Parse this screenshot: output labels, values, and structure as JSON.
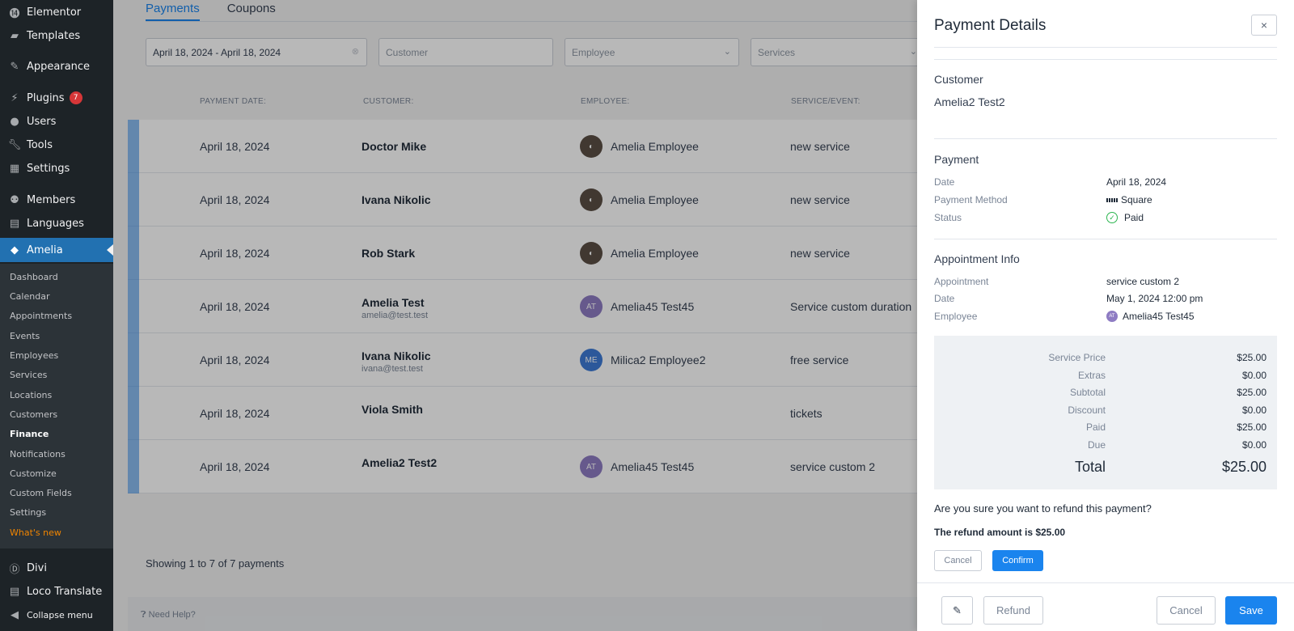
{
  "wp_menu": {
    "elementor": "Elementor",
    "templates": "Templates",
    "appearance": "Appearance",
    "plugins": "Plugins",
    "plugins_badge": "7",
    "users": "Users",
    "tools": "Tools",
    "settings": "Settings",
    "members": "Members",
    "languages": "Languages",
    "amelia": "Amelia",
    "divi": "Divi",
    "loco": "Loco Translate",
    "collapse": "Collapse menu"
  },
  "amelia_submenu": [
    "Dashboard",
    "Calendar",
    "Appointments",
    "Events",
    "Employees",
    "Services",
    "Locations",
    "Customers",
    "Finance",
    "Notifications",
    "Customize",
    "Custom Fields",
    "Settings",
    "What's new"
  ],
  "tabs": [
    "Payments",
    "Coupons"
  ],
  "filters": {
    "date_range": "April 18, 2024 - April 18, 2024",
    "customer_placeholder": "Customer",
    "employee_placeholder": "Employee",
    "services_placeholder": "Services"
  },
  "table": {
    "headers": [
      "PAYMENT DATE:",
      "CUSTOMER:",
      "EMPLOYEE:",
      "SERVICE/EVENT:"
    ],
    "rows": [
      {
        "date": "April 18, 2024",
        "customer": "Doctor Mike",
        "email": "",
        "avatar": "",
        "employee": "Amelia Employee",
        "service": "new service"
      },
      {
        "date": "April 18, 2024",
        "customer": "Ivana Nikolic",
        "email": "",
        "avatar": "",
        "employee": "Amelia Employee",
        "service": "new service"
      },
      {
        "date": "April 18, 2024",
        "customer": "Rob Stark",
        "email": "",
        "avatar": "",
        "employee": "Amelia Employee",
        "service": "new service"
      },
      {
        "date": "April 18, 2024",
        "customer": "Amelia Test",
        "email": "amelia@test.test",
        "avatar": "AT",
        "employee": "Amelia45 Test45",
        "service": "Service custom duration"
      },
      {
        "date": "April 18, 2024",
        "customer": "Ivana Nikolic",
        "email": "ivana@test.test",
        "avatar": "ME",
        "employee": "Milica2 Employee2",
        "service": "free service"
      },
      {
        "date": "April 18, 2024",
        "customer": "Viola Smith",
        "email": "",
        "avatar": "",
        "employee": "",
        "service": "tickets"
      },
      {
        "date": "April 18, 2024",
        "customer": "Amelia2 Test2",
        "email": "",
        "avatar": "AT",
        "employee": "Amelia45 Test45",
        "service": "service custom 2"
      }
    ]
  },
  "showing": "Showing 1 to 7 of 7 payments",
  "need_help": "Need Help?",
  "panel": {
    "title": "Payment Details",
    "close": "×",
    "customer_title": "Customer",
    "customer_name": "Amelia2 Test2",
    "payment_title": "Payment",
    "date_label": "Date",
    "date_value": "April 18, 2024",
    "method_label": "Payment Method",
    "method_value": "Square",
    "status_label": "Status",
    "status_value": "Paid",
    "appt_title": "Appointment Info",
    "appt_label": "Appointment",
    "appt_value": "service custom 2",
    "appt_date_label": "Date",
    "appt_date_value": "May 1, 2024 12:00 pm",
    "employee_label": "Employee",
    "employee_value": "Amelia45 Test45",
    "employee_avatar": "AT",
    "totals": [
      {
        "label": "Service Price",
        "value": "$25.00"
      },
      {
        "label": "Extras",
        "value": "$0.00"
      },
      {
        "label": "Subtotal",
        "value": "$25.00"
      },
      {
        "label": "Discount",
        "value": "$0.00"
      },
      {
        "label": "Paid",
        "value": "$25.00"
      },
      {
        "label": "Due",
        "value": "$0.00"
      }
    ],
    "total_label": "Total",
    "total_value": "$25.00",
    "refund_question": "Are you sure you want to refund this payment?",
    "refund_amount": "The refund amount is $25.00",
    "refund_cancel": "Cancel",
    "refund_confirm": "Confirm",
    "refund_button": "Refund",
    "cancel_button": "Cancel",
    "save_button": "Save"
  },
  "colors": {
    "accent": "#1a84ee",
    "wp_active": "#2271b1",
    "paid": "#2bb54f",
    "badge": "#d63638"
  }
}
